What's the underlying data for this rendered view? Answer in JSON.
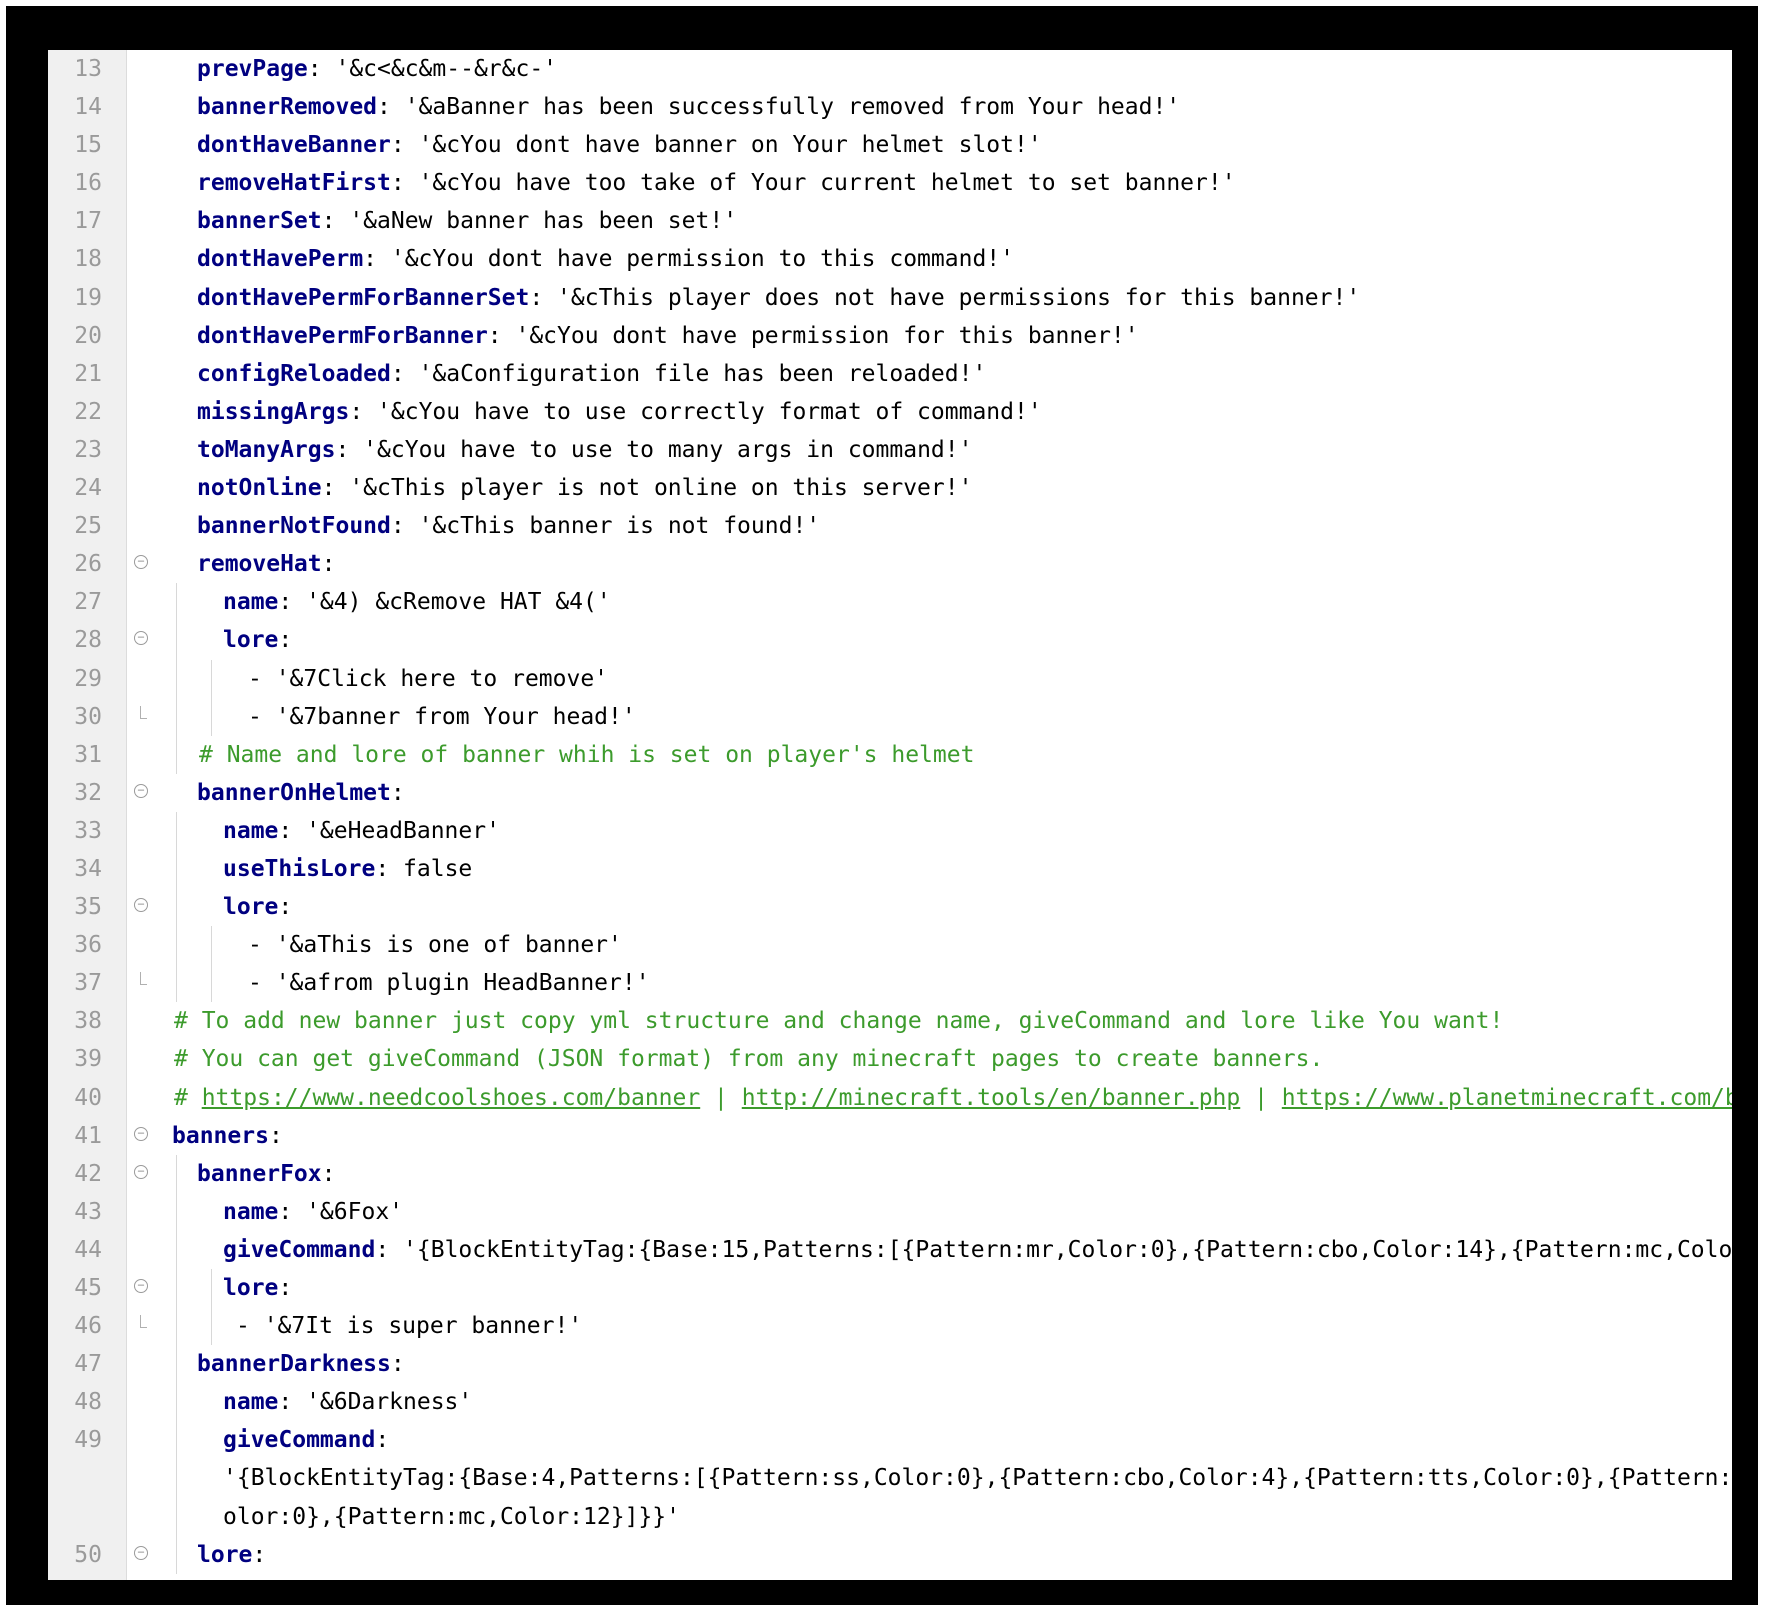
{
  "colors": {
    "key": "#000080",
    "comment": "#3c9b2c",
    "line_number": "#9a9a9a",
    "gutter_bg": "#f0f0f0",
    "frame": "#000000"
  },
  "lines": [
    {
      "num": "13",
      "key": "prevPage",
      "rest": ": '&c<&c&m--&r&c-'"
    },
    {
      "num": "14",
      "key": "bannerRemoved",
      "rest": ": '&aBanner has been successfully removed from Your head!'"
    },
    {
      "num": "15",
      "key": "dontHaveBanner",
      "rest": ": '&cYou dont have banner on Your helmet slot!'"
    },
    {
      "num": "16",
      "key": "removeHatFirst",
      "rest": ": '&cYou have too take of Your current helmet to set banner!'"
    },
    {
      "num": "17",
      "key": "bannerSet",
      "rest": ": '&aNew banner has been set!'"
    },
    {
      "num": "18",
      "key": "dontHavePerm",
      "rest": ": '&cYou dont have permission to this command!'"
    },
    {
      "num": "19",
      "key": "dontHavePermForBannerSet",
      "rest": ": '&cThis player does not have permissions for this banner!'"
    },
    {
      "num": "20",
      "key": "dontHavePermForBanner",
      "rest": ": '&cYou dont have permission for this banner!'"
    },
    {
      "num": "21",
      "key": "configReloaded",
      "rest": ": '&aConfiguration file has been reloaded!'"
    },
    {
      "num": "22",
      "key": "missingArgs",
      "rest": ": '&cYou have to use correctly format of command!'"
    },
    {
      "num": "23",
      "key": "toManyArgs",
      "rest": ": '&cYou have to use to many args in command!'"
    },
    {
      "num": "24",
      "key": "notOnline",
      "rest": ": '&cThis player is not online on this server!'"
    },
    {
      "num": "25",
      "key": "bannerNotFound",
      "rest": ": '&cThis banner is not found!'"
    },
    {
      "num": "26",
      "key": "removeHat",
      "rest": ":"
    },
    {
      "num": "27",
      "key": "name",
      "rest": ": '&4) &cRemove HAT &4('"
    },
    {
      "num": "28",
      "key": "lore",
      "rest": ":"
    },
    {
      "num": "29",
      "rest": "- '&7Click here to remove'"
    },
    {
      "num": "30",
      "rest": "- '&7banner from Your head!'"
    },
    {
      "num": "31",
      "comment": "# Name and lore of banner whih is set on player's helmet"
    },
    {
      "num": "32",
      "key": "bannerOnHelmet",
      "rest": ":"
    },
    {
      "num": "33",
      "key": "name",
      "rest": ": '&eHeadBanner'"
    },
    {
      "num": "34",
      "key": "useThisLore",
      "rest": ": false"
    },
    {
      "num": "35",
      "key": "lore",
      "rest": ":"
    },
    {
      "num": "36",
      "rest": "- '&aThis is one of banner'"
    },
    {
      "num": "37",
      "rest": "- '&afrom plugin HeadBanner!'"
    },
    {
      "num": "38",
      "comment": "# To add new banner just copy yml structure and change name, giveCommand and lore like You want!"
    },
    {
      "num": "39",
      "comment": "# You can get giveCommand (JSON format) from any minecraft pages to create banners."
    },
    {
      "num": "40",
      "comment": "# ",
      "link1": "https://www.needcoolshoes.com/banner",
      "sep1": " | ",
      "link2": "http://minecraft.tools/en/banner.php",
      "sep2": " | ",
      "link3": "https://www.planetminecraft.com/b"
    },
    {
      "num": "41",
      "key": "banners",
      "rest": ":"
    },
    {
      "num": "42",
      "key": "bannerFox",
      "rest": ":"
    },
    {
      "num": "43",
      "key": "name",
      "rest": ": '&6Fox'"
    },
    {
      "num": "44",
      "key": "giveCommand",
      "rest": ": '{BlockEntityTag:{Base:15,Patterns:[{Pattern:mr,Color:0},{Pattern:cbo,Color:14},{Pattern:mc,Colo"
    },
    {
      "num": "45",
      "key": "lore",
      "rest": ":"
    },
    {
      "num": "46",
      "rest": "- '&7It is super banner!'"
    },
    {
      "num": "47",
      "key": "bannerDarkness",
      "rest": ":"
    },
    {
      "num": "48",
      "key": "name",
      "rest": ": '&6Darkness'"
    },
    {
      "num": "49",
      "key": "giveCommand",
      "rest": ":"
    },
    {
      "num": "",
      "rest": "'{BlockEntityTag:{Base:4,Patterns:[{Pattern:ss,Color:0},{Pattern:cbo,Color:4},{Pattern:tts,Color:0},{Pattern:"
    },
    {
      "num": "",
      "rest": "olor:0},{Pattern:mc,Color:12}]}}'"
    },
    {
      "num": "50",
      "key": "lore",
      "rest": ":"
    }
  ]
}
